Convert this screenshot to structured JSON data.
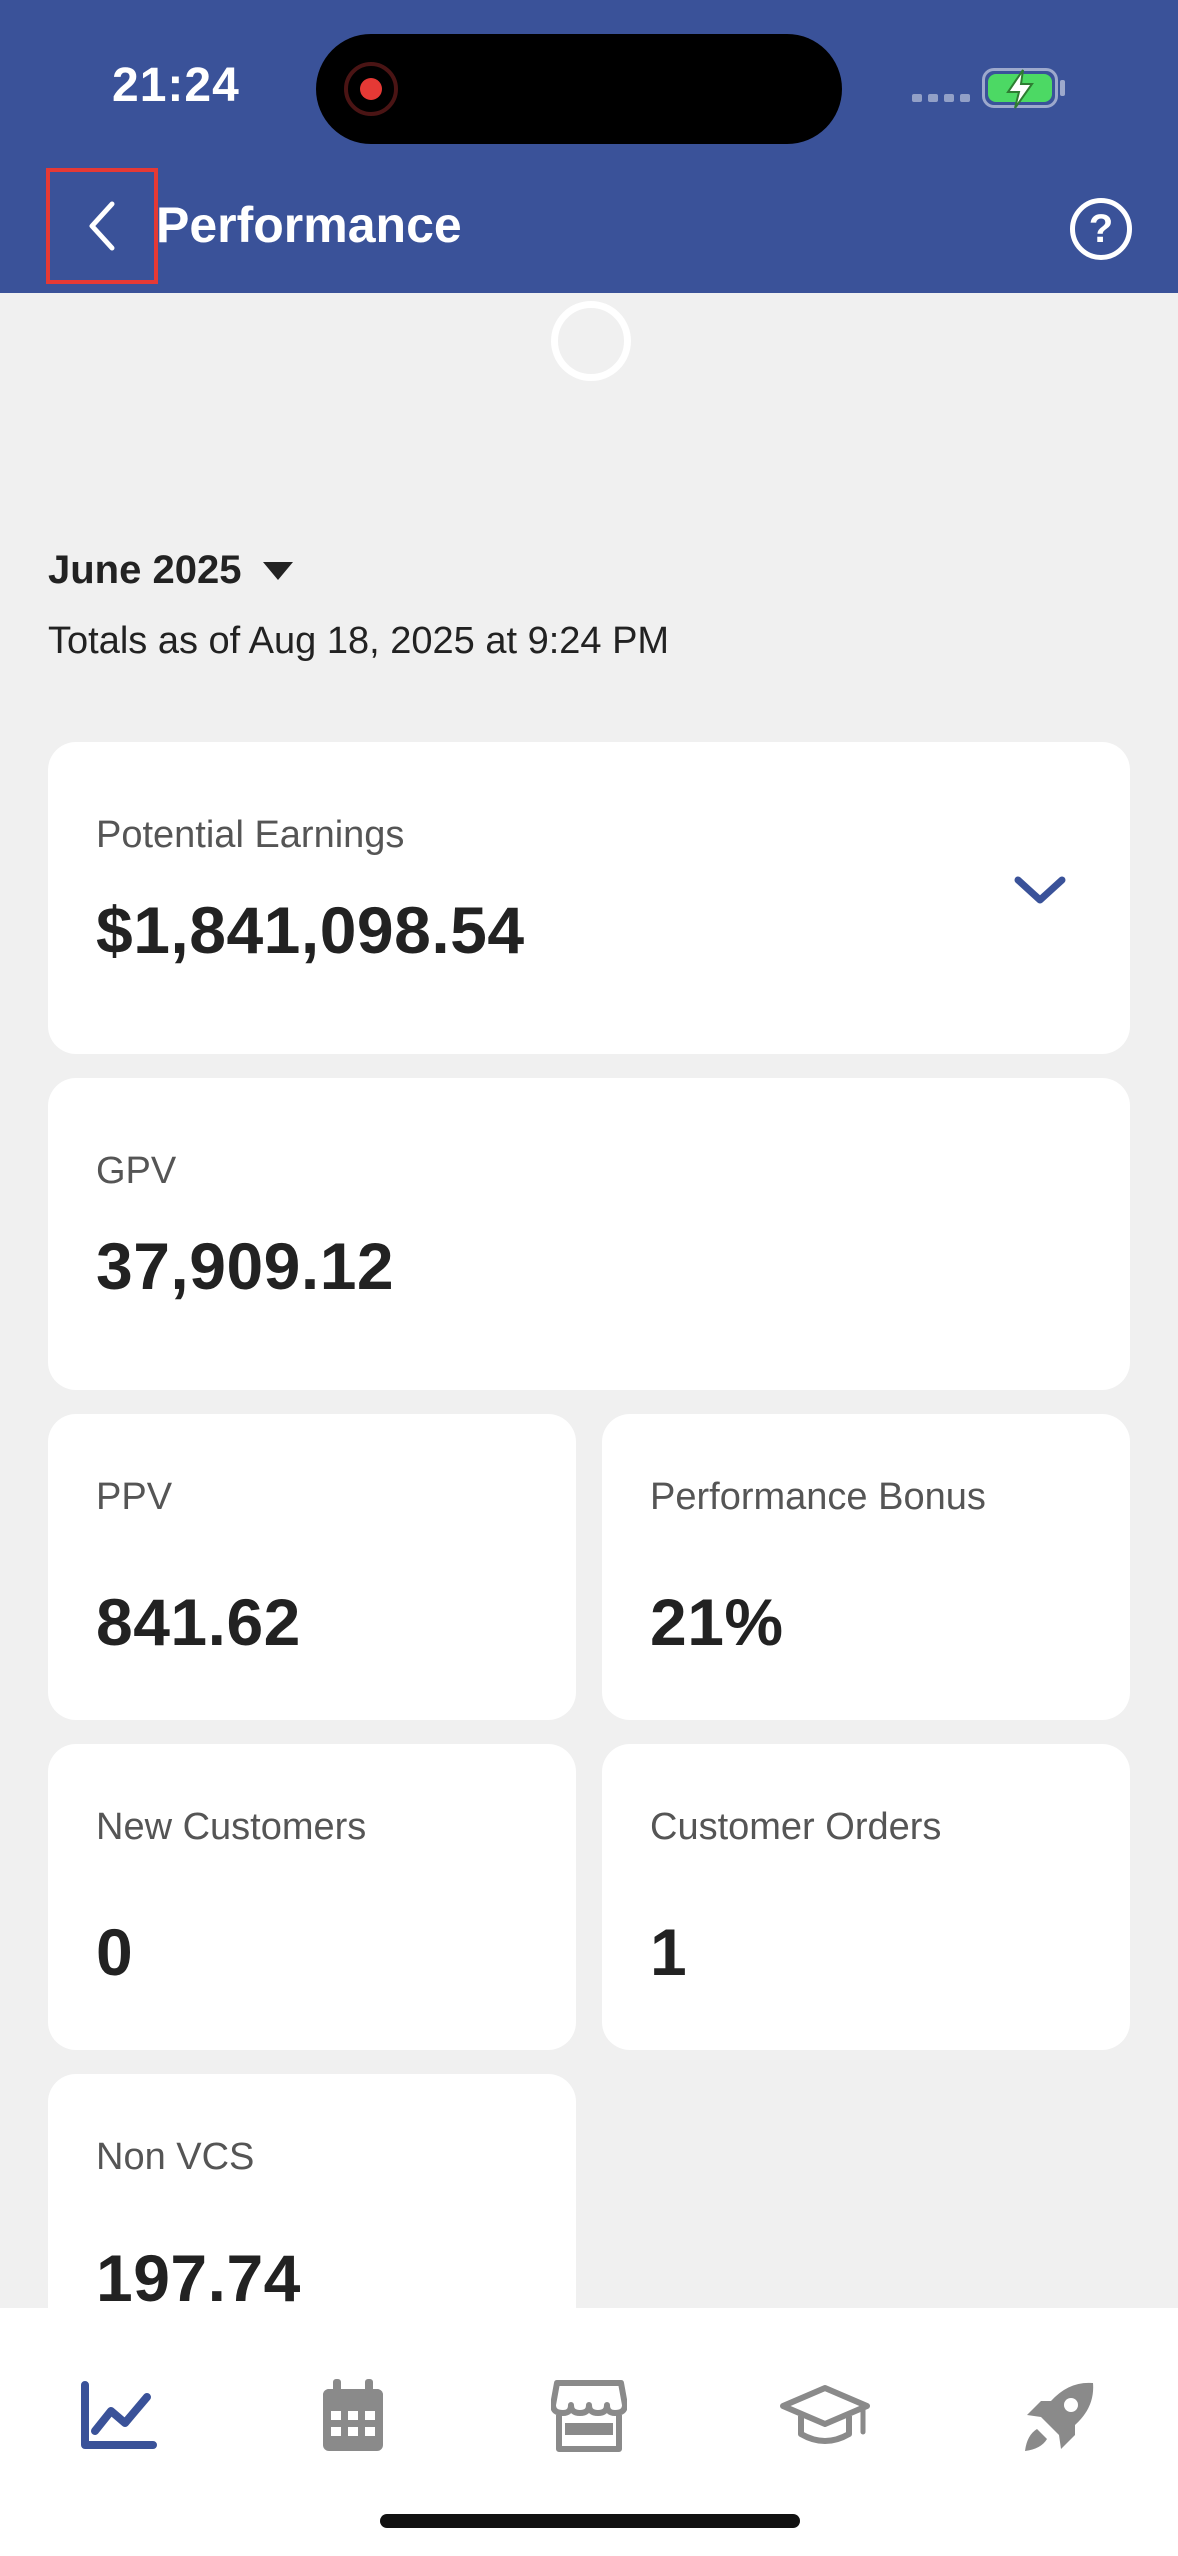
{
  "status_bar": {
    "time": "21:24"
  },
  "header": {
    "title": "Performance",
    "back_icon": "chevron-left-icon",
    "help_label": "?"
  },
  "period": {
    "label": "June 2025",
    "totals_text": "Totals as of Aug 18, 2025 at 9:24 PM"
  },
  "cards": {
    "potential_earnings": {
      "label": "Potential Earnings",
      "value": "$1,841,098.54"
    },
    "gpv": {
      "label": "GPV",
      "value": "37,909.12"
    },
    "ppv": {
      "label": "PPV",
      "value": "841.62"
    },
    "performance_bonus": {
      "label": "Performance Bonus",
      "value": "21%"
    },
    "new_customers": {
      "label": "New Customers",
      "value": "0"
    },
    "customer_orders": {
      "label": "Customer Orders",
      "value": "1"
    },
    "non_vcs": {
      "label": "Non VCS",
      "value": "197.74"
    }
  },
  "tabbar": {
    "tabs": [
      {
        "icon": "chart-line-icon",
        "active": true
      },
      {
        "icon": "calendar-icon",
        "active": false
      },
      {
        "icon": "store-icon",
        "active": false
      },
      {
        "icon": "graduation-cap-icon",
        "active": false
      },
      {
        "icon": "rocket-icon",
        "active": false
      }
    ]
  },
  "colors": {
    "brand": "#3a5299",
    "active_tab": "#3a5299",
    "inactive_tab": "#8a8a8a",
    "background": "#f0f0f0",
    "card": "#ffffff",
    "highlight_box": "#e53935"
  }
}
